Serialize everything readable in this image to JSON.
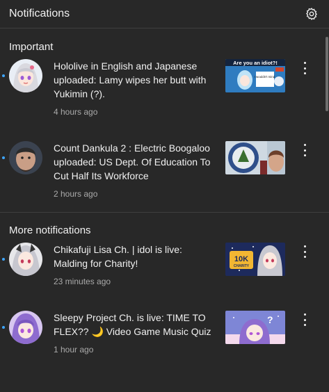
{
  "header": {
    "title": "Notifications",
    "settings_icon": "gear-icon"
  },
  "sections": [
    {
      "title": "Important",
      "items": [
        {
          "message": "Hololive in English and Japanese uploaded: Lamy wipes her butt with Yukimin (?).",
          "time": "4 hours ago",
          "thumb_text_1": "Are you an idiot?!",
          "thumb_text_2": "I wouldn't mind."
        },
        {
          "message": "Count Dankula 2 : Electric Boogaloo uploaded: US Dept. Of Education To Cut Half Its Workforce",
          "time": "2 hours ago"
        }
      ]
    },
    {
      "title": "More notifications",
      "items": [
        {
          "message": "Chikafuji Lisa Ch. | idol is live: Malding for Charity!",
          "time": "23 minutes ago",
          "thumb_text_1": "10K",
          "thumb_text_2": "CHARITY"
        },
        {
          "message": "Sleepy Project Ch. is live: TIME TO FLEX?? 🌙 Video Game Music Quiz",
          "time": "1 hour ago",
          "thumb_text_1": "?"
        }
      ]
    }
  ],
  "colors": {
    "background": "#282828",
    "text": "#f1f1f1",
    "secondary": "#aaaaaa",
    "unread_dot": "#3ea6ff",
    "divider": "#3f3f3f"
  }
}
